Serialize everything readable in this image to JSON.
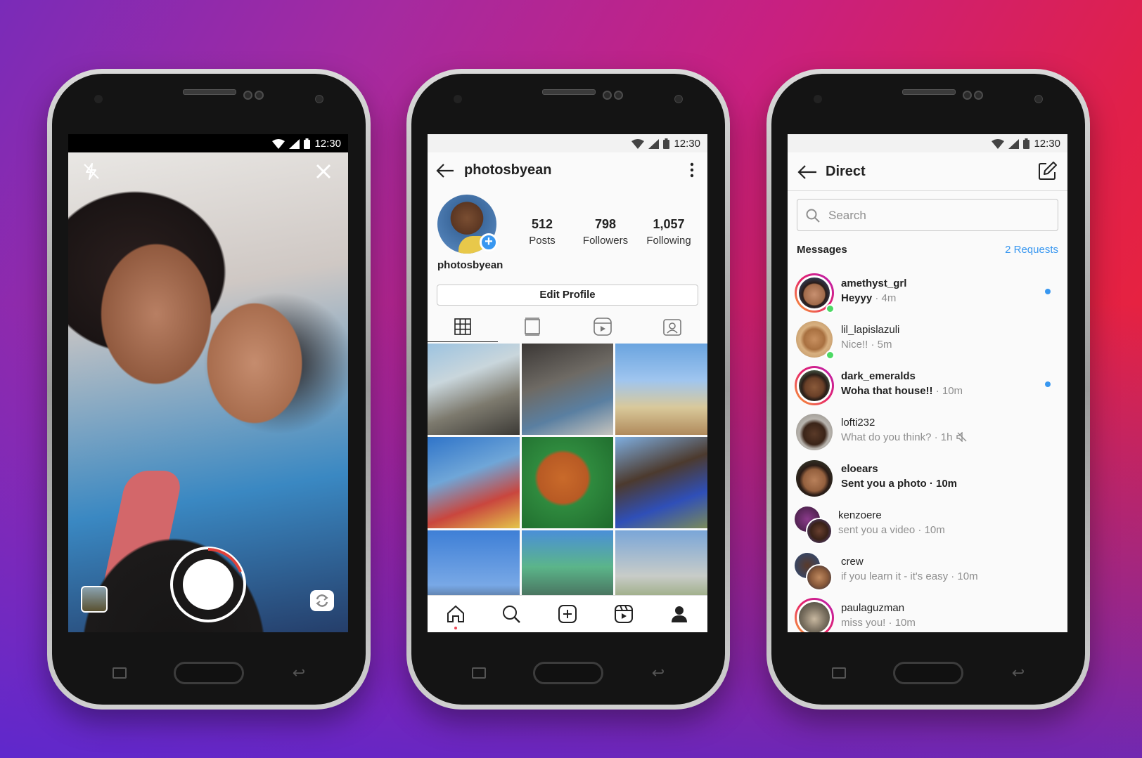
{
  "status": {
    "time": "12:30"
  },
  "colors": {
    "accent_blue": "#3897f0",
    "notification_red": "#ed4956",
    "online_green": "#4cd964"
  },
  "camera": {
    "icons": [
      "flash-off-icon",
      "close-icon",
      "shutter-button",
      "gallery-icon",
      "flip-camera-icon"
    ]
  },
  "profile": {
    "username": "photosbyean",
    "display_name": "photosbyean",
    "stats": [
      {
        "value": "512",
        "label": "Posts"
      },
      {
        "value": "798",
        "label": "Followers"
      },
      {
        "value": "1,057",
        "label": "Following"
      }
    ],
    "edit_button": "Edit Profile",
    "tabs": [
      "grid-icon",
      "igtv-icon",
      "reels-icon",
      "tagged-icon"
    ],
    "nav": [
      "home-icon",
      "search-icon",
      "add-post-icon",
      "reels-icon",
      "profile-icon"
    ]
  },
  "direct": {
    "title": "Direct",
    "search_placeholder": "Search",
    "messages_label": "Messages",
    "requests_label": "2 Requests",
    "threads": [
      {
        "name": "amethyst_grl",
        "preview": "Heyyy",
        "time": " · 4m",
        "unread": true,
        "online": true,
        "ring": true
      },
      {
        "name": "lil_lapislazuli",
        "preview": "Nice!!",
        "time": " · 5m",
        "unread": false,
        "online": true,
        "ring": false
      },
      {
        "name": "dark_emeralds",
        "preview": "Woha that house!!",
        "time": " · 10m",
        "unread": true,
        "online": false,
        "ring": true
      },
      {
        "name": "lofti232",
        "preview": "What do you think?",
        "time": " · 1h",
        "unread": false,
        "online": false,
        "ring": false,
        "muted": true
      },
      {
        "name": "eloears",
        "preview": "Sent you a photo",
        "time": " · 10m",
        "unread": true,
        "online": false,
        "ring": false,
        "bold_time": true
      },
      {
        "name": "kenzoere",
        "preview": "sent you a video",
        "time": " · 10m",
        "unread": false,
        "online": false,
        "ring": false,
        "group": true
      },
      {
        "name": "crew",
        "preview": "if you learn it - it's easy",
        "time": " · 10m",
        "unread": false,
        "online": false,
        "ring": false,
        "group": true
      },
      {
        "name": "paulaguzman",
        "preview": "miss you!",
        "time": " · 10m",
        "unread": false,
        "online": false,
        "ring": true
      }
    ]
  }
}
